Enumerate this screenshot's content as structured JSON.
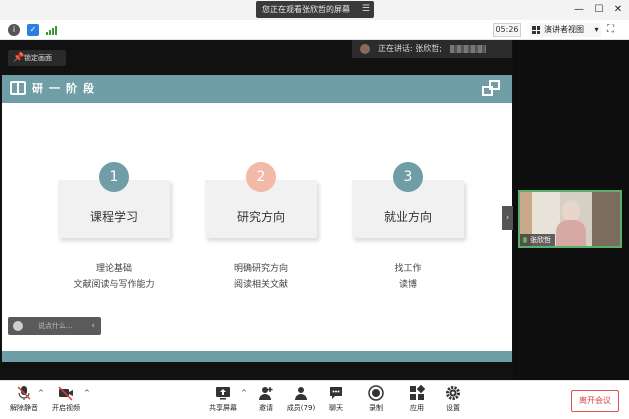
{
  "titlebar": {
    "share_text": "您正在观看张欣哲的屏幕",
    "menu_icon": "menu-lines-icon",
    "minimize": "—",
    "maximize": "☐",
    "close": "✕"
  },
  "infobar": {
    "timer": "05:26",
    "view_button": "演讲者视图",
    "view_caret": "▾"
  },
  "stage": {
    "lock_label": "锁定画面",
    "speaking_label": "正在讲话: 张欣哲;"
  },
  "slide": {
    "header_title": "研一阶段",
    "cards": [
      {
        "num": "1",
        "label": "课程学习",
        "lines": [
          "理论基础",
          "文献阅读与写作能力"
        ],
        "color": "#6f9ea6"
      },
      {
        "num": "2",
        "label": "研究方向",
        "lines": [
          "明确研究方向",
          "阅读相关文献"
        ],
        "color": "#f2b9a8"
      },
      {
        "num": "3",
        "label": "就业方向",
        "lines": [
          "找工作",
          "读博"
        ],
        "color": "#6f9ea6"
      }
    ]
  },
  "chat": {
    "placeholder": "说点什么...",
    "chevron": "‹"
  },
  "collapse": "›",
  "video": {
    "name": "张欣哲"
  },
  "toolbar": {
    "mute": "解除静音",
    "video": "开启视频",
    "share": "共享屏幕",
    "invite": "邀请",
    "members": "成员(79)",
    "chat": "聊天",
    "record": "录制",
    "apps": "应用",
    "settings": "设置",
    "leave": "离开会议",
    "caret": "^"
  },
  "colors": {
    "accent": "#6f9ea6",
    "highlight": "#f2b9a8",
    "leave": "#e04040",
    "active_speaker": "#5ab06a"
  }
}
